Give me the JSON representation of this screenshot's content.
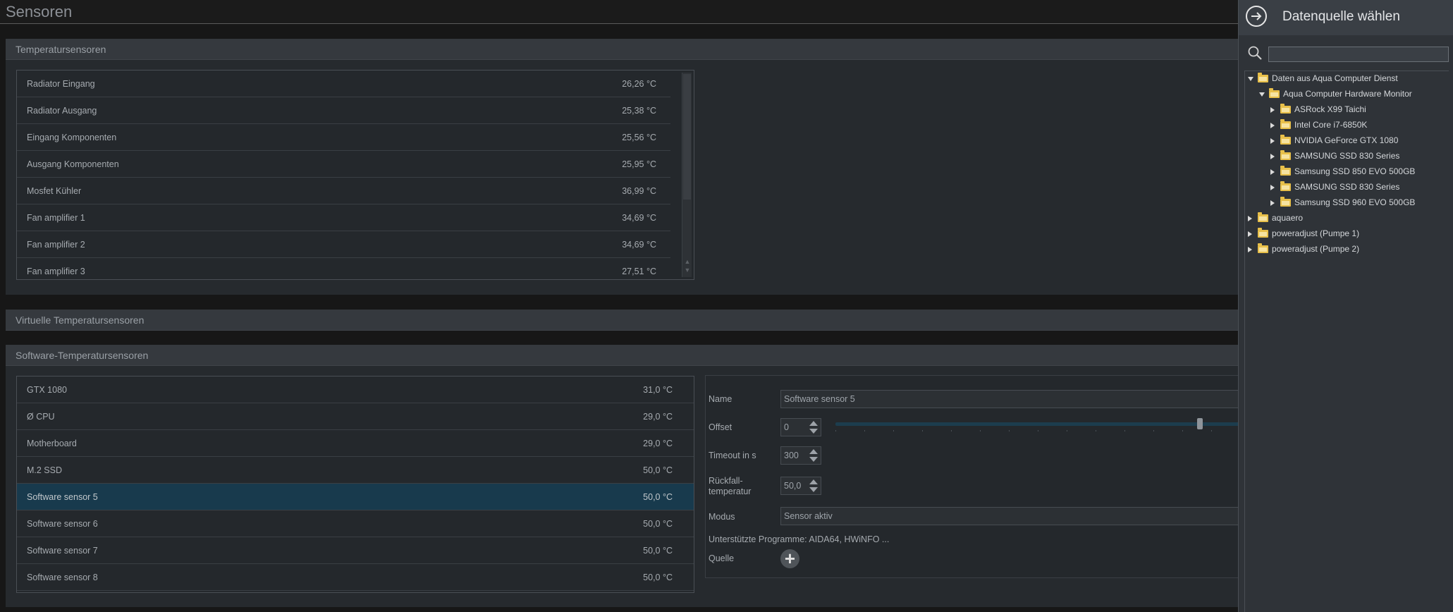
{
  "page": {
    "title": "Sensoren"
  },
  "temp_sensors": {
    "title": "Temperatursensoren",
    "rows": [
      {
        "name": "Radiator Eingang",
        "value": "26,26 °C"
      },
      {
        "name": "Radiator Ausgang",
        "value": "25,38 °C"
      },
      {
        "name": "Eingang Komponenten",
        "value": "25,56 °C"
      },
      {
        "name": "Ausgang Komponenten",
        "value": "25,95 °C"
      },
      {
        "name": "Mosfet Kühler",
        "value": "36,99 °C"
      },
      {
        "name": "Fan amplifier 1",
        "value": "34,69 °C"
      },
      {
        "name": "Fan amplifier 2",
        "value": "34,69 °C"
      },
      {
        "name": "Fan amplifier 3",
        "value": "27,51 °C"
      }
    ]
  },
  "virtual_sensors": {
    "title": "Virtuelle Temperatursensoren"
  },
  "software_sensors": {
    "title": "Software-Temperatursensoren",
    "rows": [
      {
        "name": "GTX 1080",
        "value": "31,0 °C"
      },
      {
        "name": "Ø CPU",
        "value": "29,0 °C"
      },
      {
        "name": "Motherboard",
        "value": "29,0 °C"
      },
      {
        "name": "M.2 SSD",
        "value": "50,0 °C"
      },
      {
        "name": "Software sensor 5",
        "value": "50,0 °C",
        "selected": true
      },
      {
        "name": "Software sensor 6",
        "value": "50,0 °C"
      },
      {
        "name": "Software sensor 7",
        "value": "50,0 °C"
      },
      {
        "name": "Software sensor 8",
        "value": "50,0 °C"
      }
    ]
  },
  "detail": {
    "name_label": "Name",
    "name_value": "Software sensor 5",
    "offset_label": "Offset",
    "offset_value": "0",
    "offset_slider_fraction": 0.89,
    "timeout_label": "Timeout in s",
    "timeout_value": "300",
    "fallback_label_line1": "Rückfall-",
    "fallback_label_line2": "temperatur",
    "fallback_value": "50,0",
    "mode_label": "Modus",
    "mode_value": "Sensor aktiv",
    "supported_programs": "Unterstützte Programme: AIDA64, HWiNFO ...",
    "source_label": "Quelle",
    "add_icon": "plus-circle-icon"
  },
  "datasource": {
    "title": "Datenquelle wählen",
    "search_value": "",
    "tree": [
      {
        "label": "Daten aus Aqua Computer Dienst",
        "level": 0,
        "state": "expanded"
      },
      {
        "label": "Aqua Computer Hardware Monitor",
        "level": 1,
        "state": "expanded"
      },
      {
        "label": "ASRock X99 Taichi",
        "level": 2,
        "state": "collapsed"
      },
      {
        "label": "Intel Core i7-6850K",
        "level": 2,
        "state": "collapsed"
      },
      {
        "label": "NVIDIA GeForce GTX 1080",
        "level": 2,
        "state": "collapsed"
      },
      {
        "label": "SAMSUNG SSD 830 Series",
        "level": 2,
        "state": "collapsed"
      },
      {
        "label": "Samsung SSD 850 EVO 500GB",
        "level": 2,
        "state": "collapsed"
      },
      {
        "label": "SAMSUNG SSD 830 Series",
        "level": 2,
        "state": "collapsed"
      },
      {
        "label": "Samsung SSD 960 EVO 500GB",
        "level": 2,
        "state": "collapsed"
      },
      {
        "label": "aquaero",
        "level": 0,
        "state": "collapsed"
      },
      {
        "label": "poweradjust (Pumpe 1)",
        "level": 0,
        "state": "collapsed"
      },
      {
        "label": "poweradjust (Pumpe 2)",
        "level": 0,
        "state": "collapsed"
      }
    ]
  },
  "colors": {
    "selected_row": "#183a4d",
    "folder": "#e8c04a",
    "panel": "#2f3338"
  }
}
